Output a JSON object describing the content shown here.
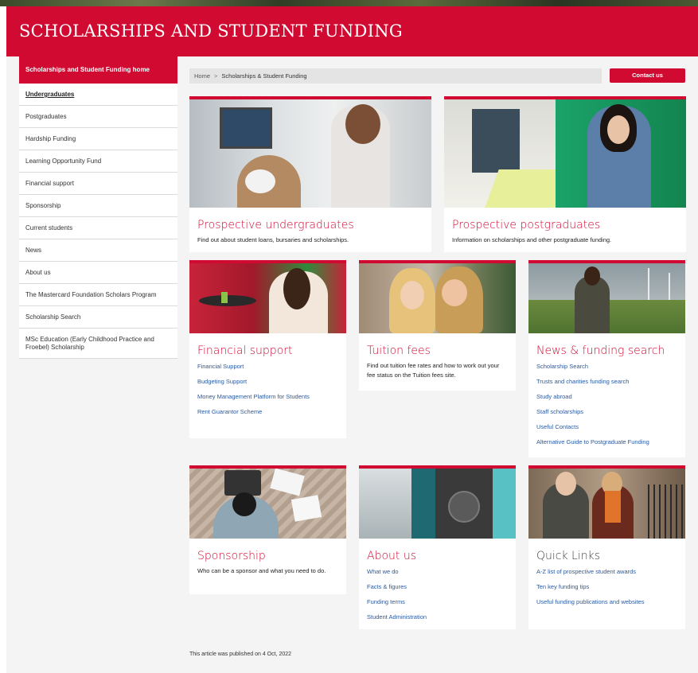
{
  "header": {
    "title": "SCHOLARSHIPS AND STUDENT FUNDING"
  },
  "sidebar": {
    "items": [
      {
        "label": "Scholarships and Student Funding home"
      },
      {
        "label": "Undergraduates"
      },
      {
        "label": "Postgraduates"
      },
      {
        "label": "Hardship Funding"
      },
      {
        "label": "Learning Opportunity Fund"
      },
      {
        "label": "Financial support"
      },
      {
        "label": "Sponsorship"
      },
      {
        "label": "Current students"
      },
      {
        "label": "News"
      },
      {
        "label": "About us"
      },
      {
        "label": "The Mastercard Foundation Scholars Program"
      },
      {
        "label": "Scholarship Search"
      },
      {
        "label": "MSc Education (Early Childhood Practice and Froebel) Scholarship"
      }
    ]
  },
  "breadcrumb": {
    "home": "Home",
    "separator": ">",
    "current": "Scholarships & Student Funding"
  },
  "contact_button": "Contact us",
  "cards": {
    "prospective_ug": {
      "title": "Prospective undergraduates",
      "text": "Find out about student loans, bursaries and scholarships."
    },
    "prospective_pg": {
      "title": "Prospective postgraduates",
      "text": "Information on scholarships and other postgraduate funding."
    },
    "financial": {
      "title": "Financial support",
      "links": [
        "Financial Support",
        "Budgeting Support",
        "Money Management Platform for Students",
        "Rent Guarantor Scheme"
      ]
    },
    "tuition": {
      "title": "Tuition fees",
      "text": "Find out tuition fee rates and how to work out your fee status on the Tuition fees site."
    },
    "news": {
      "title": "News & funding search",
      "links": [
        "Scholarship Search",
        "Trusts and charities funding search",
        "Study abroad",
        "Staff scholarships",
        "Useful Contacts",
        "Alternative Guide to Postgraduate Funding"
      ]
    },
    "sponsorship": {
      "title": "Sponsorship",
      "text": "Who can be a sponsor and what you need to do."
    },
    "about": {
      "title": "About us",
      "links": [
        "What we do",
        "Facts & figures",
        "Funding terms",
        "Student Administration"
      ]
    },
    "quick": {
      "title": "Quick Links",
      "links": [
        "A-Z list of prospective student awards",
        "Ten key funding tips",
        "Useful funding publications and websites"
      ]
    }
  },
  "footer": {
    "published": "This article was published on 4 Oct, 2022"
  },
  "colors": {
    "brand_red": "#d10a32",
    "link_blue": "#2b5aa0",
    "page_bg": "#f4f4f4"
  }
}
